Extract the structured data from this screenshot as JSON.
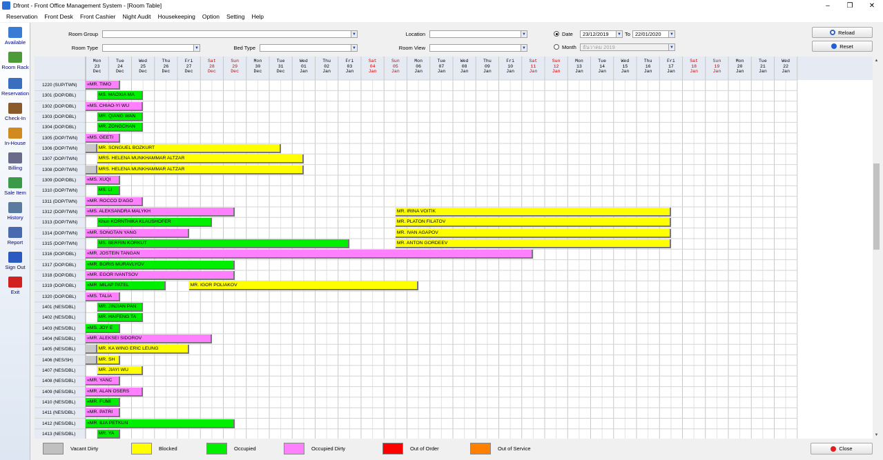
{
  "window": {
    "title": "Dfront - Front Office Management System - [Room Table]",
    "min": "–",
    "max": "❐",
    "close": "✕"
  },
  "menu": [
    "Reservation",
    "Front Desk",
    "Front Cashier",
    "Night Audit",
    "Housekeeping",
    "Option",
    "Setting",
    "Help"
  ],
  "sidebar": [
    {
      "label": "Available",
      "icon": "calendar-icon",
      "color": "#3a7bd5"
    },
    {
      "label": "Room Rack",
      "icon": "room-rack-icon",
      "color": "#4c9a3a"
    },
    {
      "label": "Reservation",
      "icon": "book-icon",
      "color": "#3a6fc0"
    },
    {
      "label": "Check-In",
      "icon": "suitcase-icon",
      "color": "#8a5a2a"
    },
    {
      "label": "In-House",
      "icon": "house-icon",
      "color": "#d08a20"
    },
    {
      "label": "Billing",
      "icon": "cash-register-icon",
      "color": "#6a6a8a"
    },
    {
      "label": "Sale Item",
      "icon": "bottles-icon",
      "color": "#3a9a4a"
    },
    {
      "label": "History",
      "icon": "history-icon",
      "color": "#5a7aa0"
    },
    {
      "label": "Report",
      "icon": "report-icon",
      "color": "#4a6ab0"
    },
    {
      "label": "Sign Out",
      "icon": "sign-out-icon",
      "color": "#2a5ac0"
    },
    {
      "label": "Exit",
      "icon": "power-icon",
      "color": "#d02020"
    }
  ],
  "filters": {
    "room_group_label": "Room Group",
    "room_type_label": "Room Type",
    "bed_type_label": "Bed Type",
    "location_label": "Location",
    "room_view_label": "Room View",
    "date_radio_label": "Date",
    "date_from": "23/12/2019",
    "to_label": "To",
    "date_to": "22/01/2020",
    "month_radio_label": "Month",
    "month_value": "ธันวาคม 2019",
    "reload_label": "Reload",
    "reset_label": "Reset"
  },
  "days": [
    {
      "dow": "Mon",
      "d": "23",
      "m": "Dec"
    },
    {
      "dow": "Tue",
      "d": "24",
      "m": "Dec"
    },
    {
      "dow": "Wed",
      "d": "25",
      "m": "Dec"
    },
    {
      "dow": "Thu",
      "d": "26",
      "m": "Dec"
    },
    {
      "dow": "Fri",
      "d": "27",
      "m": "Dec"
    },
    {
      "dow": "Sat",
      "d": "28",
      "m": "Dec",
      "we": true
    },
    {
      "dow": "Sun",
      "d": "29",
      "m": "Dec",
      "we": true
    },
    {
      "dow": "Mon",
      "d": "30",
      "m": "Dec"
    },
    {
      "dow": "Tue",
      "d": "31",
      "m": "Dec"
    },
    {
      "dow": "Wed",
      "d": "01",
      "m": "Jan"
    },
    {
      "dow": "Thu",
      "d": "02",
      "m": "Jan"
    },
    {
      "dow": "Fri",
      "d": "03",
      "m": "Jan"
    },
    {
      "dow": "Sat",
      "d": "04",
      "m": "Jan",
      "we": true
    },
    {
      "dow": "Sun",
      "d": "05",
      "m": "Jan",
      "we": true
    },
    {
      "dow": "Mon",
      "d": "06",
      "m": "Jan"
    },
    {
      "dow": "Tue",
      "d": "07",
      "m": "Jan"
    },
    {
      "dow": "Wed",
      "d": "08",
      "m": "Jan"
    },
    {
      "dow": "Thu",
      "d": "09",
      "m": "Jan"
    },
    {
      "dow": "Fri",
      "d": "10",
      "m": "Jan"
    },
    {
      "dow": "Sat",
      "d": "11",
      "m": "Jan",
      "we": true
    },
    {
      "dow": "Sun",
      "d": "12",
      "m": "Jan",
      "we": true
    },
    {
      "dow": "Mon",
      "d": "13",
      "m": "Jan"
    },
    {
      "dow": "Tue",
      "d": "14",
      "m": "Jan"
    },
    {
      "dow": "Wed",
      "d": "15",
      "m": "Jan"
    },
    {
      "dow": "Thu",
      "d": "16",
      "m": "Jan"
    },
    {
      "dow": "Fri",
      "d": "17",
      "m": "Jan"
    },
    {
      "dow": "Sat",
      "d": "18",
      "m": "Jan",
      "we": true
    },
    {
      "dow": "Sun",
      "d": "19",
      "m": "Jan",
      "we": true
    },
    {
      "dow": "Mon",
      "d": "20",
      "m": "Jan"
    },
    {
      "dow": "Tue",
      "d": "21",
      "m": "Jan"
    },
    {
      "dow": "Wed",
      "d": "22",
      "m": "Jan"
    }
  ],
  "rooms": [
    {
      "room": "1220 (SUP/TWN)",
      "bars": [
        {
          "s": 0,
          "e": 1.5,
          "name": "«MR. TIMO",
          "st": "p"
        }
      ]
    },
    {
      "room": "1301 (DOP/DBL)",
      "bars": [
        {
          "s": 0.5,
          "e": 2.5,
          "name": "MS. MAOXIA MA",
          "st": "g"
        }
      ]
    },
    {
      "room": "1302 (DOP/DBL)",
      "bars": [
        {
          "s": 0,
          "e": 2.5,
          "name": "«MS. CHIAO-YI WU",
          "st": "p"
        }
      ]
    },
    {
      "room": "1303 (DOP/DBL)",
      "bars": [
        {
          "s": 0.5,
          "e": 2.5,
          "name": "MR. QIANG WAN",
          "st": "g"
        }
      ]
    },
    {
      "room": "1304 (DOP/DBL)",
      "bars": [
        {
          "s": 0.5,
          "e": 2.5,
          "name": "MR. ZONGCHAN",
          "st": "g"
        }
      ]
    },
    {
      "room": "1305 (DOP/TWN)",
      "bars": [
        {
          "s": 0,
          "e": 1.5,
          "name": "«MS. GEETI",
          "st": "p"
        }
      ]
    },
    {
      "room": "1306 (DOP/TWN)",
      "bars": [
        {
          "s": 0,
          "e": 0.5,
          "name": "",
          "st": "c"
        },
        {
          "s": 0.5,
          "e": 8.5,
          "name": "MR. SONGUEL BOZKURT",
          "st": "y"
        }
      ]
    },
    {
      "room": "1307 (DOP/TWN)",
      "bars": [
        {
          "s": 0.5,
          "e": 9.5,
          "name": "MRS. HELENA MUNKHAMMAR ALTZAR",
          "st": "y"
        }
      ]
    },
    {
      "room": "1308 (DOP/TWN)",
      "bars": [
        {
          "s": 0,
          "e": 0.5,
          "name": "",
          "st": "c"
        },
        {
          "s": 0.5,
          "e": 9.5,
          "name": "MRS. HELENA MUNKHAMMAR ALTZAR",
          "st": "y"
        }
      ]
    },
    {
      "room": "1309 (DOP/DBL)",
      "bars": [
        {
          "s": 0,
          "e": 1.5,
          "name": "«MS. XUQI",
          "st": "p"
        }
      ]
    },
    {
      "room": "1310 (DOP/TWN)",
      "bars": [
        {
          "s": 0.5,
          "e": 1.5,
          "name": "MS. LI",
          "st": "g"
        }
      ]
    },
    {
      "room": "1311 (DOP/TWN)",
      "bars": [
        {
          "s": 0,
          "e": 2.5,
          "name": "«MR. ROCCO D'AGO",
          "st": "p"
        }
      ]
    },
    {
      "room": "1312 (DOP/TWN)",
      "bars": [
        {
          "s": 0,
          "e": 6.5,
          "name": "«MS. ALEKSANDRA MALYKH",
          "st": "p"
        },
        {
          "s": 13.5,
          "e": 25.5,
          "name": "MR. IRINA VOITIK",
          "st": "y"
        }
      ]
    },
    {
      "room": "1313 (DOP/TWN)",
      "bars": [
        {
          "s": 0.5,
          "e": 5.5,
          "name": "Khun KORNTHIKA KLAUSHOFER",
          "st": "g"
        },
        {
          "s": 13.5,
          "e": 25.5,
          "name": "MR. PLATON FILATOV",
          "st": "y"
        }
      ]
    },
    {
      "room": "1314 (DOP/TWN)",
      "bars": [
        {
          "s": 0,
          "e": 4.5,
          "name": "«MR. SONGTAN YANG",
          "st": "p"
        },
        {
          "s": 13.5,
          "e": 25.5,
          "name": "MR. IVAN AGAPOV",
          "st": "y"
        }
      ]
    },
    {
      "room": "1315 (DOP/TWN)",
      "bars": [
        {
          "s": 0.5,
          "e": 11.5,
          "name": "MS. BERRIN KORKUT",
          "st": "g"
        },
        {
          "s": 13.5,
          "e": 25.5,
          "name": "MR. ANTON GORDEEV",
          "st": "y"
        }
      ]
    },
    {
      "room": "1316 (DOP/DBL)",
      "bars": [
        {
          "s": 0,
          "e": 19.5,
          "name": "«MR. JOSTEIN TANGAN",
          "st": "p"
        }
      ]
    },
    {
      "room": "1317 (DOP/DBL)",
      "bars": [
        {
          "s": 0,
          "e": 6.5,
          "name": "«MR. BORIS MURAVLYOV",
          "st": "g"
        }
      ]
    },
    {
      "room": "1318 (DOP/DBL)",
      "bars": [
        {
          "s": 0,
          "e": 6.5,
          "name": "«MR. EGOR IVANTSOV",
          "st": "p"
        }
      ]
    },
    {
      "room": "1319 (DOP/DBL)",
      "bars": [
        {
          "s": 0,
          "e": 3.5,
          "name": "«MR. MILAP PATEL",
          "st": "g"
        },
        {
          "s": 4.5,
          "e": 14.5,
          "name": "MR. IGOR POLIAKOV",
          "st": "y"
        }
      ]
    },
    {
      "room": "1320 (DOP/DBL)",
      "bars": [
        {
          "s": 0,
          "e": 1.5,
          "name": "«MS. TALIA",
          "st": "p"
        }
      ]
    },
    {
      "room": "1401 (NES/DBL)",
      "bars": [
        {
          "s": 0.5,
          "e": 2.5,
          "name": "MR. JINJIAN PAN",
          "st": "g"
        }
      ]
    },
    {
      "room": "1402 (NES/DBL)",
      "bars": [
        {
          "s": 0.5,
          "e": 2.5,
          "name": "MR. HAIFENG TA",
          "st": "g"
        }
      ]
    },
    {
      "room": "1403 (NES/DBL)",
      "bars": [
        {
          "s": 0,
          "e": 1.5,
          "name": "«MS. JOY E",
          "st": "g"
        }
      ]
    },
    {
      "room": "1404 (NES/DBL)",
      "bars": [
        {
          "s": 0,
          "e": 5.5,
          "name": "«MR. ALEKSEI SIDOROV",
          "st": "p"
        }
      ]
    },
    {
      "room": "1405 (NES/DBL)",
      "bars": [
        {
          "s": 0,
          "e": 0.5,
          "name": "",
          "st": "c"
        },
        {
          "s": 0.5,
          "e": 4.5,
          "name": "MR. KA WING ERIC LEUNG",
          "st": "y"
        }
      ]
    },
    {
      "room": "1406 (NES/SH)",
      "bars": [
        {
          "s": 0,
          "e": 0.5,
          "name": "",
          "st": "c"
        },
        {
          "s": 0.5,
          "e": 1.5,
          "name": "MR. SH",
          "st": "y"
        }
      ]
    },
    {
      "room": "1407 (NES/DBL)",
      "bars": [
        {
          "s": 0.5,
          "e": 2.5,
          "name": "MR. JIAYI WU",
          "st": "y"
        }
      ]
    },
    {
      "room": "1408 (NES/DBL)",
      "bars": [
        {
          "s": 0,
          "e": 1.5,
          "name": "«MR. YANC",
          "st": "p"
        }
      ]
    },
    {
      "room": "1409 (NES/DBL)",
      "bars": [
        {
          "s": 0,
          "e": 2.5,
          "name": "«MR. ALAN OSERS",
          "st": "p"
        }
      ]
    },
    {
      "room": "1410 (NES/DBL)",
      "bars": [
        {
          "s": 0,
          "e": 1.5,
          "name": "«MR. FUMI",
          "st": "g"
        }
      ]
    },
    {
      "room": "1411 (NES/DBL)",
      "bars": [
        {
          "s": 0,
          "e": 1.5,
          "name": "«MR. PATRI",
          "st": "p"
        }
      ]
    },
    {
      "room": "1412 (NES/DBL)",
      "bars": [
        {
          "s": 0,
          "e": 6.5,
          "name": "«MR. ILIA PETKUN",
          "st": "g"
        }
      ]
    },
    {
      "room": "1413 (NES/DBL)",
      "bars": [
        {
          "s": 0.5,
          "e": 1.5,
          "name": "MR. YA",
          "st": "g"
        }
      ]
    }
  ],
  "legend": [
    {
      "label": "Vacant Dirty",
      "color": "#c0c0c0"
    },
    {
      "label": "Blocked",
      "color": "#ffff00"
    },
    {
      "label": "Occupied",
      "color": "#00ee00"
    },
    {
      "label": "Occupied Dirty",
      "color": "#ff80ff"
    },
    {
      "label": "Out of Order",
      "color": "#ff0000"
    },
    {
      "label": "Out of Service",
      "color": "#ff8000"
    }
  ],
  "close_label": "Close"
}
